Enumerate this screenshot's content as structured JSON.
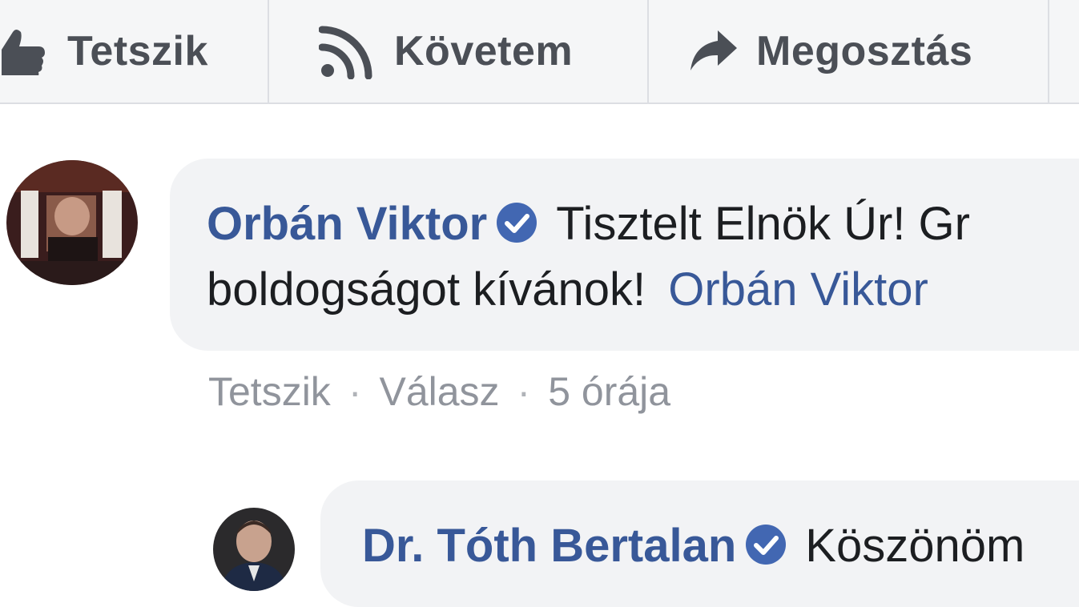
{
  "action_bar": {
    "like_label": "Tetszik",
    "follow_label": "Követem",
    "share_label": "Megosztás"
  },
  "comments": [
    {
      "author": "Orbán Viktor",
      "verified": true,
      "text_line1": "Tisztelt Elnök Úr! Gr",
      "text_line2": "boldogságot kívánok!",
      "mention": "Orbán Viktor",
      "actions": {
        "like": "Tetszik",
        "reply": "Válasz",
        "time": "5 órája"
      }
    },
    {
      "author": "Dr. Tóth Bertalan",
      "verified": true,
      "text_line1": "Köszönöm"
    }
  ],
  "colors": {
    "author_link": "#385898",
    "verified_badge": "#4267b2",
    "bubble": "#f2f3f5",
    "meta_text": "#90949c",
    "action_text": "#4b4f56"
  },
  "icons": [
    "thumbs-up-icon",
    "rss-follow-icon",
    "share-arrow-icon",
    "verified-badge-icon"
  ]
}
